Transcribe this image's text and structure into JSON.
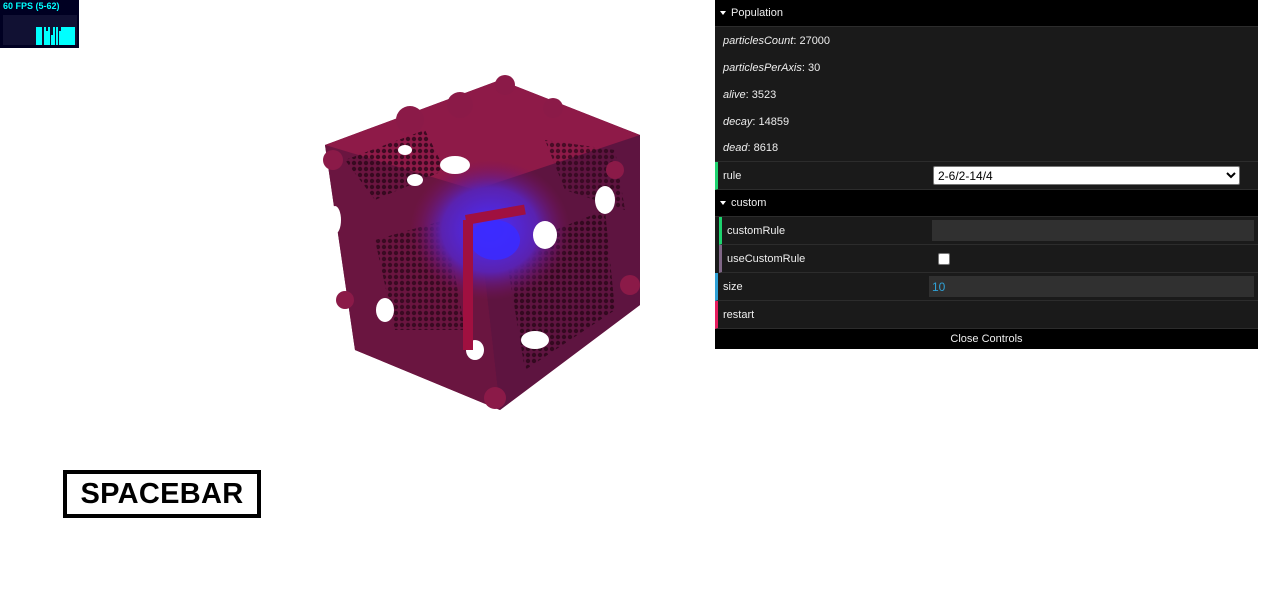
{
  "stats": {
    "fps_text": "60 FPS (5-62)"
  },
  "spacebar": {
    "label": "SPACEBAR"
  },
  "gui": {
    "population": {
      "title": "Population",
      "items": [
        {
          "key": "particlesCount",
          "value": "27000"
        },
        {
          "key": "particlesPerAxis",
          "value": "30"
        },
        {
          "key": "alive",
          "value": "3523"
        },
        {
          "key": "decay",
          "value": "14859"
        },
        {
          "key": "dead",
          "value": "8618"
        }
      ]
    },
    "rule": {
      "label": "rule",
      "selected": "2-6/2-14/4"
    },
    "custom": {
      "title": "custom",
      "custom_rule": {
        "label": "customRule",
        "value": ""
      },
      "use_custom_rule": {
        "label": "useCustomRule",
        "checked": false
      }
    },
    "size": {
      "label": "size",
      "value": "10"
    },
    "restart": {
      "label": "restart"
    },
    "close_label": "Close Controls"
  },
  "colors": {
    "folder_bg": "#000000",
    "panel_bg": "#1a1a1a",
    "green": "#1ed36f",
    "blue": "#2fa1d6",
    "red": "#e61d5f",
    "purple": "#806787"
  }
}
